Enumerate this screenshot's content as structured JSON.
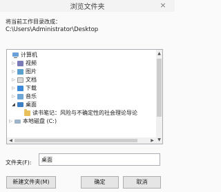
{
  "window": {
    "title": "浏览文件夹",
    "close": "×"
  },
  "description": "将当前工作目录改成：",
  "current_path": "C:\\Users\\Administrator\\Desktop",
  "tree": {
    "items": [
      {
        "label": "计算机",
        "icon": "computer-icon"
      },
      {
        "label": "视频",
        "icon": "video-folder-icon"
      },
      {
        "label": "图片",
        "icon": "pictures-folder-icon"
      },
      {
        "label": "文档",
        "icon": "documents-folder-icon"
      },
      {
        "label": "下载",
        "icon": "downloads-folder-icon"
      },
      {
        "label": "音乐",
        "icon": "music-folder-icon"
      },
      {
        "label": "桌面",
        "icon": "desktop-folder-icon"
      },
      {
        "label": "读书笔记：风险与不确定性的社会理论导论",
        "icon": "folder-icon"
      },
      {
        "label": "本地磁盘 (C:)",
        "icon": "drive-icon"
      }
    ],
    "arrow_collapsed": "▷",
    "arrow_expanded": "◢"
  },
  "scroll": {
    "up": "▲",
    "down": "▼",
    "left": "◀",
    "right": "▶"
  },
  "folder_field": {
    "label": "文件夹(F):",
    "value": "桌面"
  },
  "buttons": {
    "new_folder": "新建文件夹(M)",
    "ok": "确定",
    "cancel": "取消"
  }
}
